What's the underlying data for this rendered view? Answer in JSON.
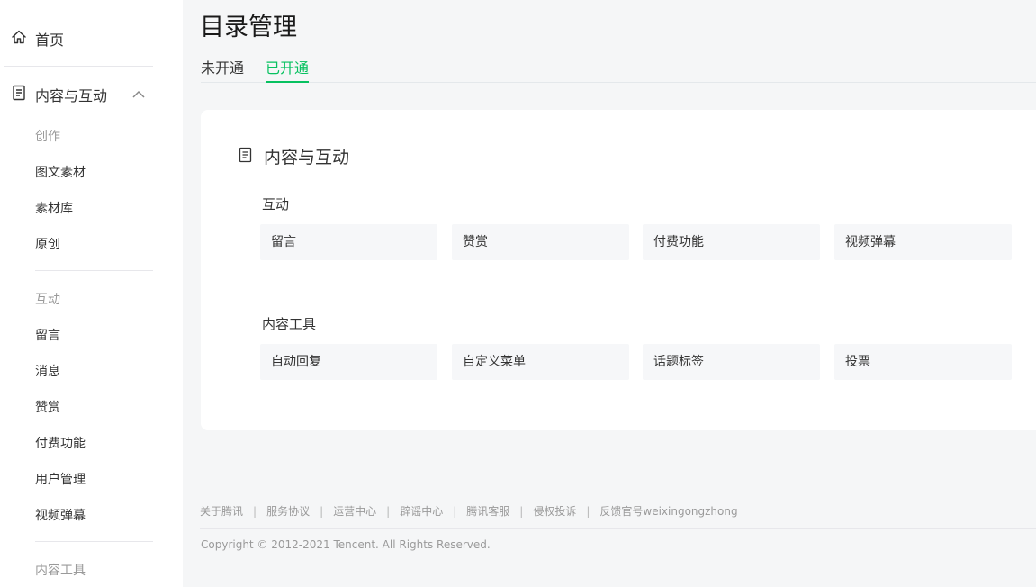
{
  "sidebar": {
    "home": {
      "label": "首页",
      "icon": "home-icon"
    },
    "group": {
      "label": "内容与互动",
      "icon": "document-icon",
      "chevron": "chevron-up-icon"
    },
    "sections": {
      "create": {
        "title": "创作",
        "items": [
          "图文素材",
          "素材库",
          "原创"
        ]
      },
      "interact": {
        "title": "互动",
        "items": [
          "留言",
          "消息",
          "赞赏",
          "付费功能",
          "用户管理",
          "视频弹幕"
        ]
      },
      "tools": {
        "title": "内容工具"
      }
    }
  },
  "main": {
    "title": "目录管理",
    "tabs": [
      {
        "label": "未开通",
        "active": false
      },
      {
        "label": "已开通",
        "active": true
      }
    ],
    "card": {
      "title": "内容与互动",
      "groups": [
        {
          "title": "互动",
          "items": [
            "留言",
            "赞赏",
            "付费功能",
            "视频弹幕"
          ]
        },
        {
          "title": "内容工具",
          "items": [
            "自动回复",
            "自定义菜单",
            "话题标签",
            "投票"
          ]
        }
      ]
    }
  },
  "footer": {
    "links": [
      "关于腾讯",
      "服务协议",
      "运营中心",
      "辟谣中心",
      "腾讯客服",
      "侵权投诉",
      "反馈官号weixingongzhong"
    ],
    "separator": "|",
    "copyright": "Copyright © 2012-2021 Tencent. All Rights Reserved."
  },
  "colors": {
    "accent": "#07c160",
    "muted": "#9a9a9a",
    "tile": "#f6f7f9"
  }
}
